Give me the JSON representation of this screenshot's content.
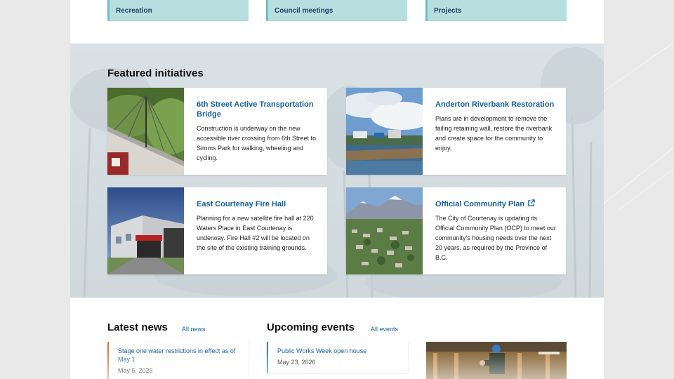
{
  "quick_links": [
    {
      "label": "Recreation"
    },
    {
      "label": "Council meetings"
    },
    {
      "label": "Projects"
    }
  ],
  "featured": {
    "title": "Featured initiatives",
    "cards": [
      {
        "title": "6th Street Active Transportation Bridge",
        "description": "Construction is underway on the new accessible river crossing from 6th Street to Simms Park for walking, wheeling and cycling."
      },
      {
        "title": "Anderton Riverbank Restoration",
        "description": "Plans are in development to remove the failing retaining wall, restore the riverbank and create space for the community to enjoy."
      },
      {
        "title": "East Courtenay Fire Hall",
        "description": "Planning for a new satellite fire hall at 220 Waters Place in East Courtenay is underway. Fire Hall #2 will be located on the site of the existing training grounds."
      },
      {
        "title": "Official Community Plan",
        "description": "The City of Courtenay is updating its Official Community Plan (OCP) to meet our community's housing needs over the next 20 years, as required by the Province of B.C.",
        "icon": "external-link-icon"
      }
    ]
  },
  "news": {
    "title": "Latest news",
    "link_label": "All news",
    "items": [
      {
        "title": "Stage one water restrictions in effect as of May 1",
        "date": "May 5, 2026"
      }
    ]
  },
  "events": {
    "title": "Upcoming events",
    "link_label": "All events",
    "items": [
      {
        "title": "Public Works Week open house",
        "date": "May 23, 2026"
      }
    ]
  },
  "colors": {
    "link_blue": "#13609b",
    "tile_teal": "#b8dfe0",
    "news_accent": "#e07a3c",
    "events_accent": "#3e8f6e"
  }
}
